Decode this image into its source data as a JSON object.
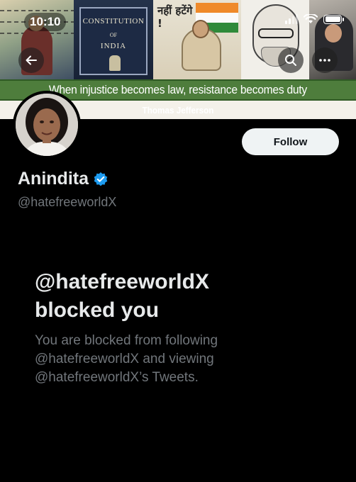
{
  "status_bar": {
    "time": "10:10"
  },
  "banner": {
    "constitution_line1": "CONSTITUTION",
    "constitution_line2": "OF",
    "constitution_line3": "INDIA",
    "hindi_text": "नहीं हटेंगे !",
    "quote": "When injustice becomes law, resistance becomes duty",
    "author": "Thomas Jefferson"
  },
  "nav": {
    "back_icon": "arrow-left-icon",
    "search_icon": "search-icon",
    "more_icon": "more-horizontal-icon"
  },
  "profile": {
    "name": "Anindita",
    "verified": true,
    "handle": "@hatefreeworldX",
    "follow_label": "Follow"
  },
  "blocked": {
    "title_line1": "@hatefreeworldX",
    "title_line2": "blocked you",
    "description": "You are blocked from following @hatefreeworldX and viewing @hatefreeworldX’s Tweets."
  },
  "colors": {
    "background": "#000000",
    "primary_text": "#e7e9ea",
    "secondary_text": "#71767b",
    "verified_blue": "#1d9bf0",
    "banner_green": "#4e7d3c"
  }
}
